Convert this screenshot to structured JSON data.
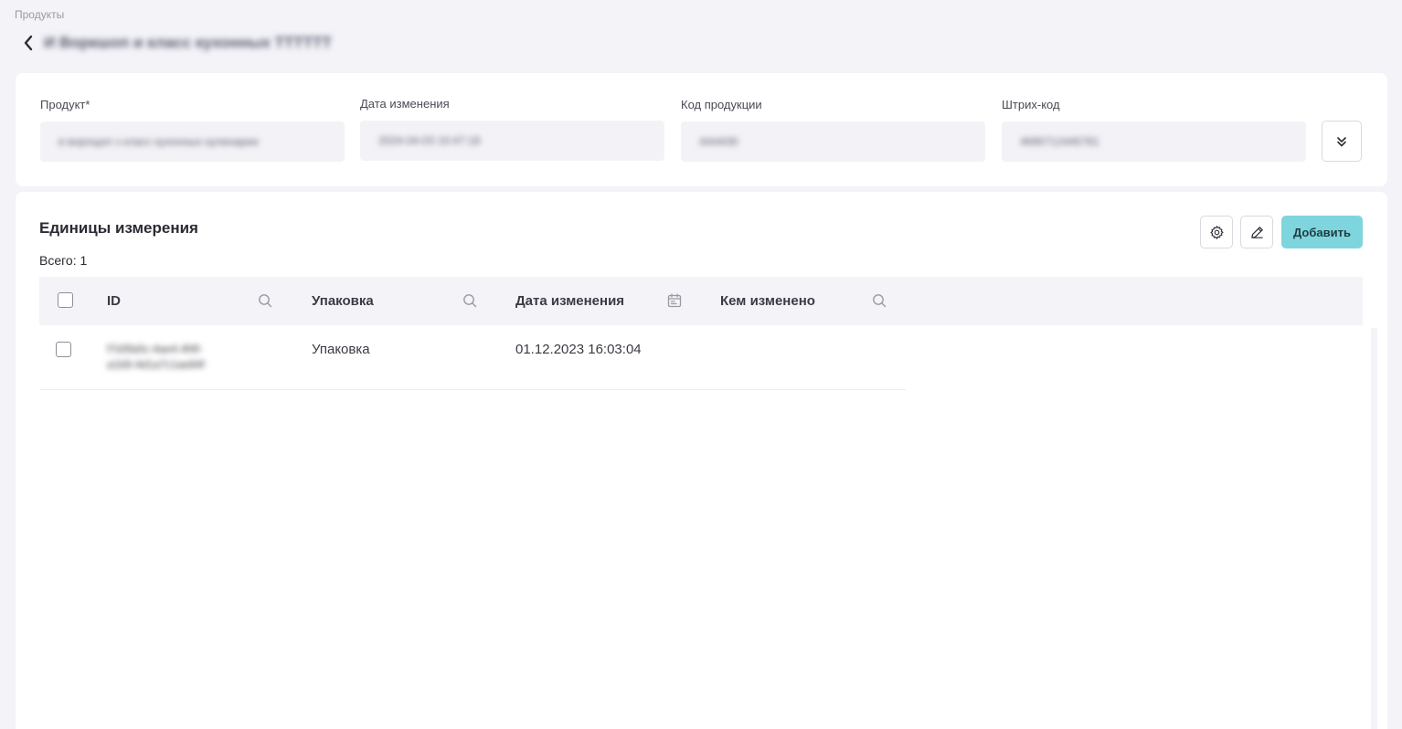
{
  "breadcrumb": "Продукты",
  "page_title": "И Воркшоп и класс кухонных ТТТТТТ",
  "product_card": {
    "fields": [
      {
        "label": "Продукт*",
        "value": "в ворлщоп з класс кухонных кулинарии"
      },
      {
        "label": "Дата изменения",
        "value": "2024-04-03 10:47:18"
      },
      {
        "label": "Код продукции",
        "value": "АА4430"
      },
      {
        "label": "Штрих-код",
        "value": "4690712445781"
      }
    ]
  },
  "units": {
    "title": "Единицы измерения",
    "total_label": "Всего: 1",
    "add_label": "Добавить",
    "columns": [
      {
        "label": "ID",
        "icon": "search-icon"
      },
      {
        "label": "Упаковка",
        "icon": "search-icon"
      },
      {
        "label": "Дата изменения",
        "icon": "calendar-icon"
      },
      {
        "label": "Кем изменено",
        "icon": "search-icon"
      }
    ],
    "rows": [
      {
        "id_line1": "f7d3fa0c-4ae4-4f4f-",
        "id_line2": "a1b9-4d1a7c1ae84f",
        "package": "Упаковка",
        "modified": "01.12.2023 16:03:04",
        "modified_by": ""
      }
    ]
  },
  "colors": {
    "accent": "#7fd5dd",
    "background": "#f3f3f8",
    "card": "#ffffff"
  }
}
